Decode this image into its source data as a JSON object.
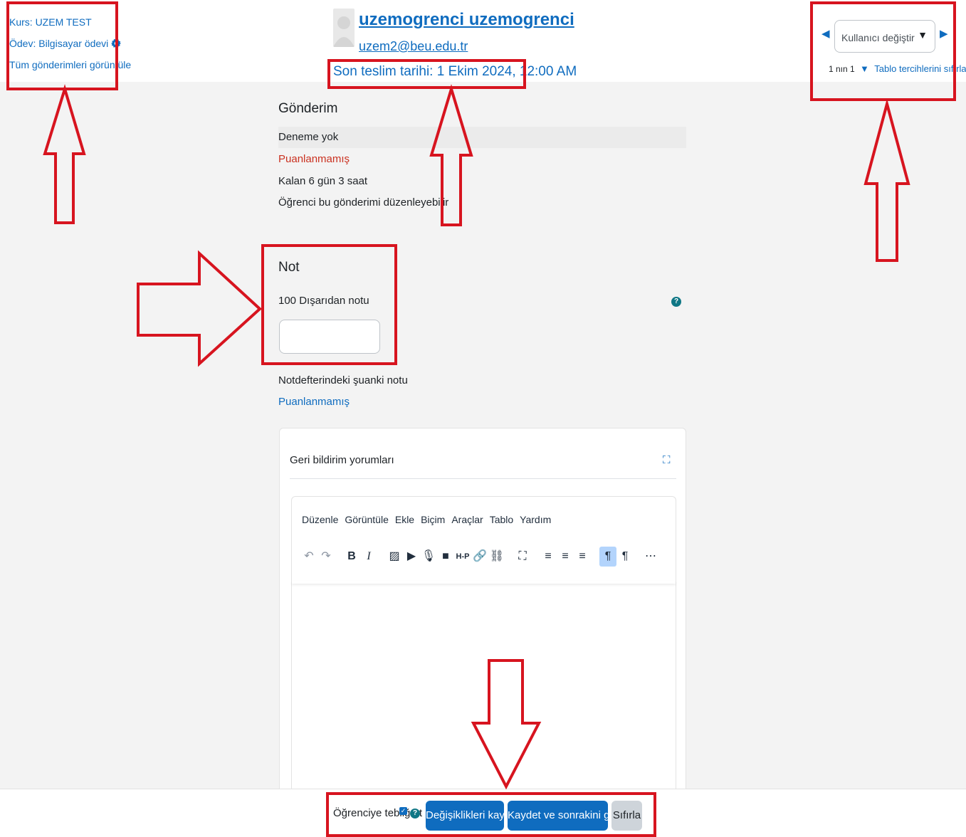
{
  "header": {
    "course_link": "Kurs: UZEM TEST",
    "assignment_link": "Ödev: Bilgisayar ödevi",
    "view_all_link": "Tüm gönderimleri görüntüle",
    "user_name": "uzemogrenci uzemogrenci",
    "user_email": "uzem2@beu.edu.tr",
    "due_date": "Son teslim tarihi: 1 Ekim 2024, 12:00 AM"
  },
  "user_nav": {
    "select_placeholder": "Kullanıcı değiştir",
    "count": "1 nın 1",
    "reset_link": "Tablo tercihlerini sıfırla"
  },
  "submission": {
    "title": "Gönderim",
    "attempt": "Deneme yok",
    "grading_status": "Puanlanmamış",
    "time_left": "Kalan 6 gün 3 saat",
    "editable": "Öğrenci bu gönderimi düzenleyebilir"
  },
  "grade": {
    "title": "Not",
    "label": "100 Dışarıdan notu",
    "current_label": "Notdefterindeki şuanki notu",
    "current_value": "Puanlanmamış"
  },
  "feedback": {
    "title": "Geri bildirim yorumları",
    "menu": [
      "Düzenle",
      "Görüntüle",
      "Ekle",
      "Biçim",
      "Araçlar",
      "Tablo",
      "Yardım"
    ]
  },
  "footer": {
    "notify_label": "Öğrenciye tebliğ et",
    "save_label": "Değişiklikleri kaydet",
    "save_next_label": "Kaydet ve sonrakini göster",
    "reset_label": "Sıfırla"
  },
  "colors": {
    "link": "#0f6cbf",
    "annotation": "#d7141f",
    "not_graded": "#ca3120"
  },
  "icons": [
    "gear-icon",
    "user-avatar",
    "prev-user-icon",
    "next-user-icon",
    "filter-icon",
    "help-icon",
    "fullscreen-icon"
  ]
}
